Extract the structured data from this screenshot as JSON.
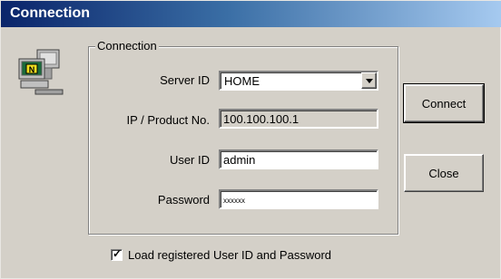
{
  "window": {
    "title": "Connection"
  },
  "group": {
    "legend": "Connection"
  },
  "form": {
    "server_id": {
      "label": "Server ID",
      "value": "HOME"
    },
    "ip": {
      "label": "IP / Product No.",
      "value": "100.100.100.1"
    },
    "user_id": {
      "label": "User ID",
      "value": "admin"
    },
    "password": {
      "label": "Password",
      "value": "xxxxxx"
    }
  },
  "buttons": {
    "connect": "Connect",
    "close": "Close"
  },
  "checkbox": {
    "label": "Load registered User ID and Password",
    "checked": true
  },
  "icons": {
    "app": "network-computer-icon",
    "dropdown": "chevron-down-icon",
    "check": "checkmark-icon"
  },
  "colors": {
    "title_start": "#0a246a",
    "title_end": "#a6caf0",
    "face": "#d4d0c8"
  }
}
